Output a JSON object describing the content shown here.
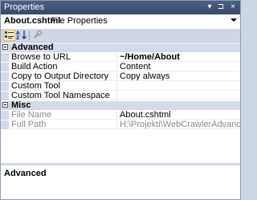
{
  "window": {
    "title": "Properties",
    "pin_glyph": "▾",
    "window_glyph": "⊐",
    "close_glyph": "×"
  },
  "object_selector": {
    "name": "About.cshtml",
    "type": "File Properties"
  },
  "toolbar": {
    "buttons": [
      {
        "name": "categorized-icon",
        "state": "selected"
      },
      {
        "name": "alphabetical-icon",
        "state": "normal"
      },
      {
        "name": "property-pages-icon",
        "state": "disabled"
      }
    ]
  },
  "grid": {
    "categories": [
      {
        "label": "Advanced",
        "properties": [
          {
            "name": "Browse to URL",
            "value": "~/Home/About",
            "bold": true
          },
          {
            "name": "Build Action",
            "value": "Content"
          },
          {
            "name": "Copy to Output Directory",
            "value": "Copy always"
          },
          {
            "name": "Custom Tool",
            "value": ""
          },
          {
            "name": "Custom Tool Namespace",
            "value": ""
          }
        ]
      },
      {
        "label": "Misc",
        "properties": [
          {
            "name": "File Name",
            "value": "About.cshtml",
            "dim_name": true
          },
          {
            "name": "Full Path",
            "value": "H:\\Projekti\\WebCrawlerAdvanced\\Octop",
            "dim": true
          }
        ]
      }
    ]
  },
  "description": {
    "title": "Advanced"
  },
  "colors": {
    "titlebar": "#3f5273",
    "category_band": "#d4dbe8",
    "toolbar": "#cfd6e5"
  }
}
